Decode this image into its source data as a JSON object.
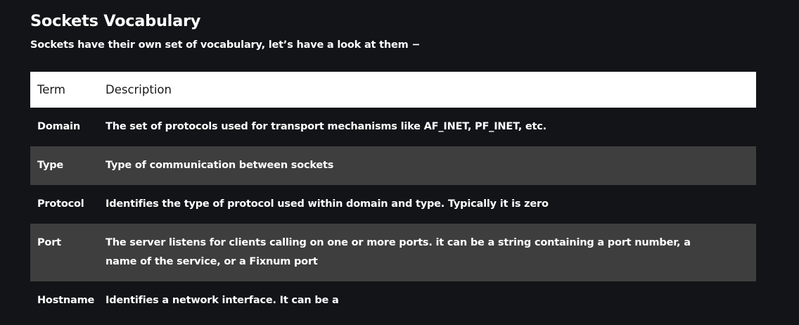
{
  "heading": {
    "title": "Sockets Vocabulary",
    "subtitle": "Sockets have their own set of vocabulary, let’s have a look at them −"
  },
  "table": {
    "columns": [
      "Term",
      "Description"
    ],
    "rows": [
      {
        "term": "Domain",
        "description": "The set of protocols used for transport mechanisms like AF_INET, PF_INET, etc."
      },
      {
        "term": "Type",
        "description": "Type of communication between sockets"
      },
      {
        "term": "Protocol",
        "description": "Identifies the type of protocol used within domain and type. Typically it is zero"
      },
      {
        "term": "Port",
        "description": "The server listens for clients calling on one or more ports. it can be a string containing a port number, a name of the service, or a Fixnum port"
      },
      {
        "term": "Hostname",
        "description": "Identifies a network interface. It can be a"
      }
    ]
  },
  "colors": {
    "background": "#131417",
    "header_row": "#ffffff",
    "striped_row": "#3e3e3e",
    "text": "#ffffff"
  }
}
